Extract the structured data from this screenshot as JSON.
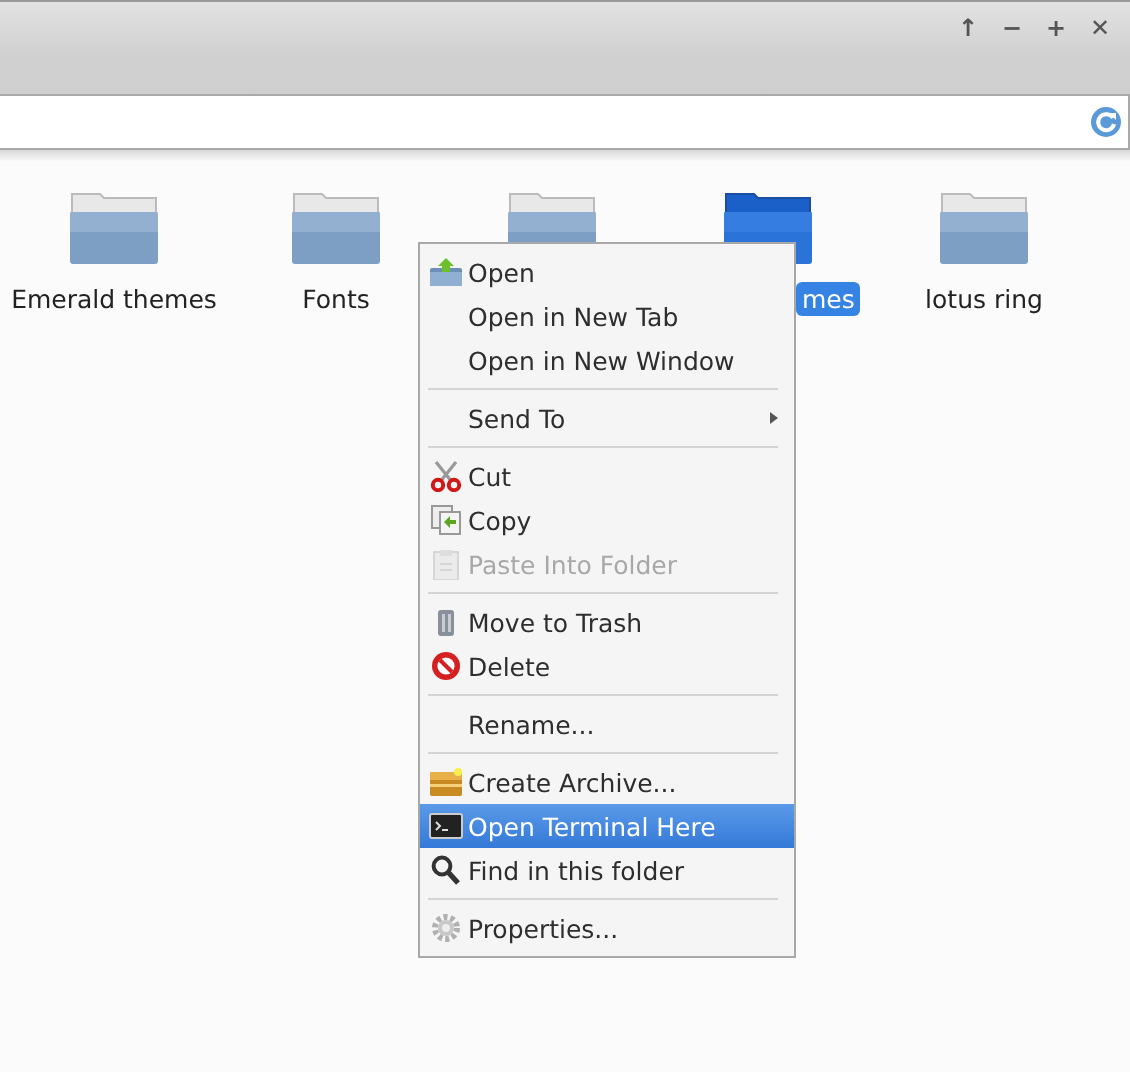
{
  "window": {
    "buttons": [
      "↑",
      "−",
      "+",
      "✕"
    ]
  },
  "folders": [
    {
      "label": "Emerald themes",
      "selected": false
    },
    {
      "label": "Fonts",
      "selected": false
    },
    {
      "selected": false
    },
    {
      "label": "mes",
      "selected": true
    },
    {
      "label": "lotus ring",
      "selected": false
    }
  ],
  "context_menu": {
    "items": [
      {
        "kind": "item",
        "label": "Open",
        "disabled": false,
        "selected": false
      },
      {
        "kind": "item",
        "label": "Open in New Tab",
        "disabled": false,
        "selected": false
      },
      {
        "kind": "item",
        "label": "Open in New Window",
        "disabled": false,
        "selected": false
      },
      {
        "kind": "separator"
      },
      {
        "kind": "submenu",
        "label": "Send To",
        "disabled": false,
        "selected": false
      },
      {
        "kind": "separator"
      },
      {
        "kind": "item",
        "label": "Cut",
        "disabled": false,
        "selected": false
      },
      {
        "kind": "item",
        "label": "Copy",
        "disabled": false,
        "selected": false
      },
      {
        "kind": "item",
        "label": "Paste Into Folder",
        "disabled": true,
        "selected": false
      },
      {
        "kind": "separator"
      },
      {
        "kind": "item",
        "label": "Move to Trash",
        "disabled": false,
        "selected": false
      },
      {
        "kind": "item",
        "label": "Delete",
        "disabled": false,
        "selected": false
      },
      {
        "kind": "separator"
      },
      {
        "kind": "item",
        "label": "Rename...",
        "disabled": false,
        "selected": false
      },
      {
        "kind": "separator"
      },
      {
        "kind": "item",
        "label": "Create Archive...",
        "disabled": false,
        "selected": false
      },
      {
        "kind": "item",
        "label": "Open Terminal Here",
        "disabled": false,
        "selected": true
      },
      {
        "kind": "item",
        "label": "Find in this folder",
        "disabled": false,
        "selected": false
      },
      {
        "kind": "separator"
      },
      {
        "kind": "item",
        "label": "Properties...",
        "disabled": false,
        "selected": false
      }
    ]
  }
}
